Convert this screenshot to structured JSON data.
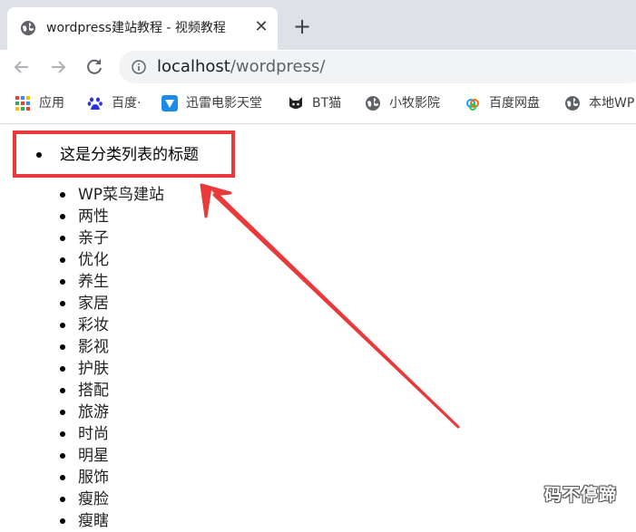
{
  "browser": {
    "tab": {
      "title": "wordpress建站教程 - 视频教程",
      "close_glyph": "✕"
    },
    "new_tab_glyph": "+",
    "url": {
      "host": "localhost",
      "path": "/wordpress/"
    },
    "bookmarks": [
      {
        "label": "应用",
        "icon": "apps-grid-icon"
      },
      {
        "label": "百度·",
        "icon": "baidu-paw-icon"
      },
      {
        "label": "迅雷电影天堂",
        "icon": "xunlei-icon"
      },
      {
        "label": "BT猫",
        "icon": "bt-cat-icon"
      },
      {
        "label": "小牧影院",
        "icon": "globe-icon"
      },
      {
        "label": "百度网盘",
        "icon": "baidu-cloud-icon"
      },
      {
        "label": "本地WP",
        "icon": "globe-icon"
      }
    ]
  },
  "page": {
    "heading": "这是分类列表的标题",
    "categories": [
      "WP菜鸟建站",
      "两性",
      "亲子",
      "优化",
      "养生",
      "家居",
      "彩妆",
      "影视",
      "护肤",
      "搭配",
      "旅游",
      "时尚",
      "明星",
      "服饰",
      "瘦脸",
      "瘦瞎"
    ]
  },
  "watermark": "码不停蹄",
  "colors": {
    "highlight": "#e8393b",
    "tab_strip": "#dee1e6",
    "omnibox": "#f1f3f4"
  }
}
